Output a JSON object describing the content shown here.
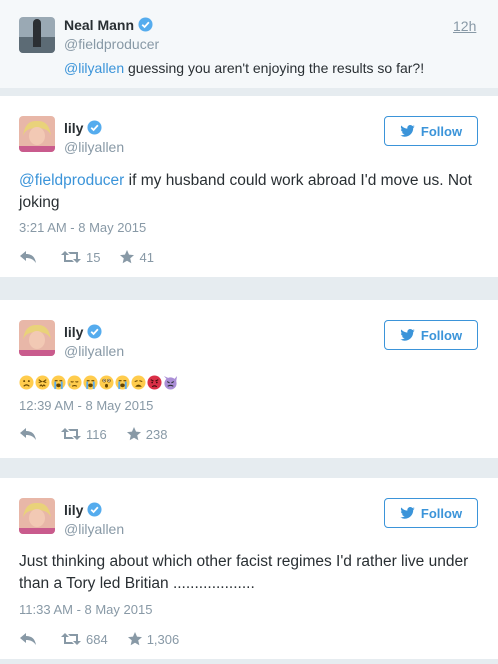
{
  "reply_context": {
    "name": "Neal Mann",
    "handle": "@fieldproducer",
    "time": "12h",
    "mention": "@lilyallen",
    "text": " guessing you aren't enjoying the results so far?!"
  },
  "tweets": [
    {
      "name": "lily",
      "handle": "@lilyallen",
      "follow_label": "Follow",
      "mention": "@fieldproducer",
      "text": " if my husband could work abroad I'd move us. Not joking",
      "timestamp": "3:21 AM - 8 May 2015",
      "retweets": "15",
      "likes": "41"
    },
    {
      "name": "lily",
      "handle": "@lilyallen",
      "follow_label": "Follow",
      "emojis": [
        "worried-face",
        "confounded-face",
        "loudly-crying-face",
        "disappointed-relieved-face",
        "loudly-crying-face",
        "astonished-face",
        "loudly-crying-face",
        "weary-face",
        "pouting-face",
        "imp"
      ],
      "timestamp": "12:39 AM - 8 May 2015",
      "retweets": "116",
      "likes": "238"
    },
    {
      "name": "lily",
      "handle": "@lilyallen",
      "follow_label": "Follow",
      "text": "Just thinking about which other facist regimes I'd rather live under than a Tory led Britian ...................",
      "timestamp": "11:33 AM - 8 May 2015",
      "retweets": "684",
      "likes": "1,306"
    }
  ],
  "colors": {
    "link": "#3b94d9",
    "muted": "#8899a6",
    "verified": "#55acee",
    "reply_bg": "#f5f8fa"
  },
  "icons": {
    "verified": "verified-badge-icon",
    "reply": "reply-icon",
    "retweet": "retweet-icon",
    "like": "star-icon",
    "follow": "twitter-bird-icon"
  }
}
